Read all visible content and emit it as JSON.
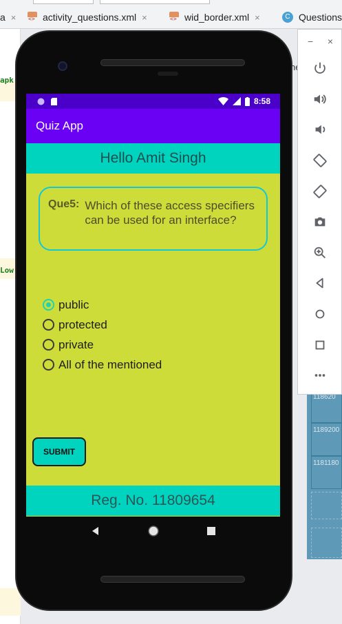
{
  "ide": {
    "tabs": [
      {
        "label": "a",
        "close": "×"
      },
      {
        "label": "activity_questions.xml",
        "close": "×"
      },
      {
        "label": "wid_border.xml",
        "close": "×"
      },
      {
        "label": "Questions"
      }
    ],
    "code_fragments": [
      "apk",
      "Low"
    ],
    "layout_ids": [
      "118620",
      "1189200",
      "1181180"
    ],
    "partial_text": "ne"
  },
  "emulator": {
    "minimize": "−",
    "close": "×",
    "buttons": [
      "power-icon",
      "volume-up-icon",
      "volume-down-icon",
      "rotate-left-icon",
      "rotate-right-icon",
      "camera-icon",
      "zoom-in-icon",
      "back-icon",
      "home-icon",
      "overview-icon",
      "more-icon"
    ]
  },
  "status_bar": {
    "time": "8:58"
  },
  "app": {
    "title": "Quiz App",
    "greeting": "Hello Amit Singh",
    "question": {
      "number": "Que5:",
      "text": "Which of these access specifiers can be used for an interface?"
    },
    "options": [
      {
        "label": "public",
        "selected": true
      },
      {
        "label": "protected",
        "selected": false
      },
      {
        "label": "private",
        "selected": false
      },
      {
        "label": "All of the mentioned",
        "selected": false
      }
    ],
    "submit_label": "SUBMIT",
    "registration": "Reg. No. 11809654"
  },
  "colors": {
    "status_bar": "#4a00c8",
    "app_bar": "#6a00f4",
    "accent": "#00d4bf",
    "background": "#cddc39"
  }
}
